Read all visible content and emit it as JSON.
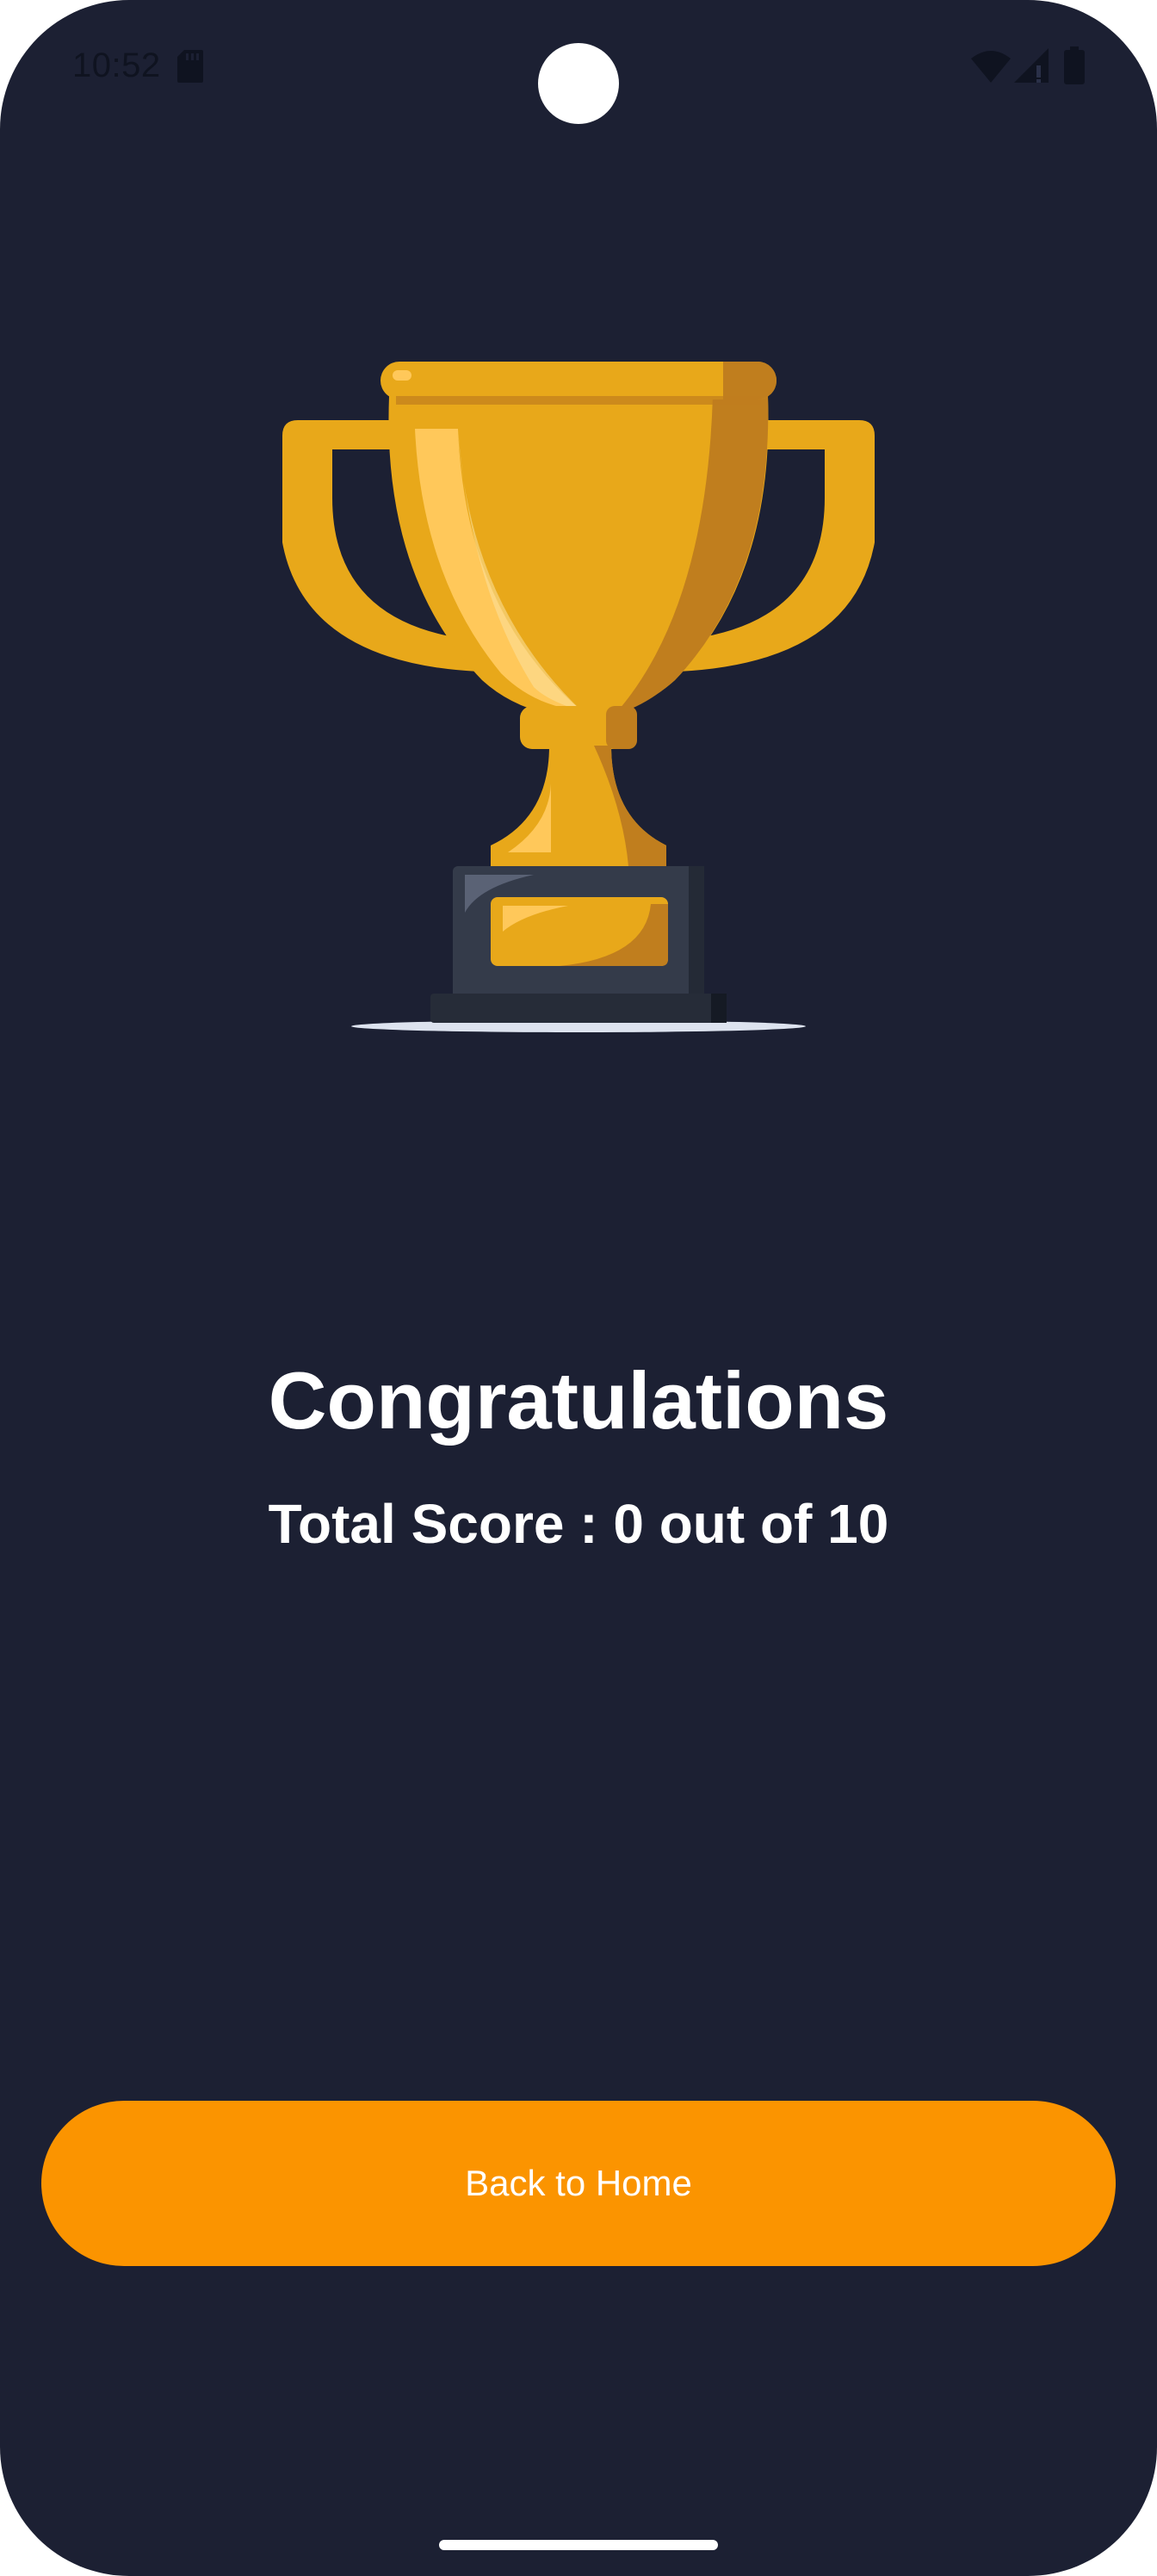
{
  "status_bar": {
    "time": "10:52",
    "icons": [
      "sd-card-icon",
      "wifi-icon",
      "cell-signal-icon",
      "battery-icon"
    ]
  },
  "result": {
    "trophy_icon": "trophy-icon",
    "title": "Congratulations",
    "score_text": "Total Score : 0 out of 10"
  },
  "actions": {
    "back_label": "Back to Home"
  },
  "colors": {
    "background": "#1c2033",
    "accent": "#fb9400",
    "gold": "#e8a81a",
    "gold_dark": "#c08020"
  }
}
